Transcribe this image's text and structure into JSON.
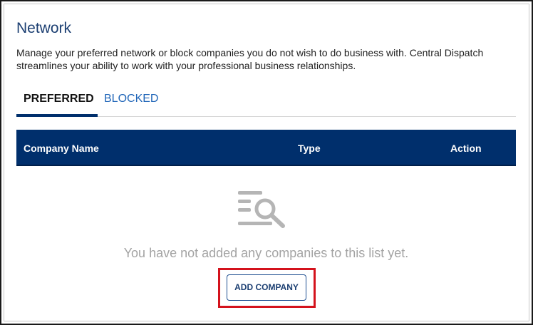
{
  "page": {
    "title": "Network",
    "description": "Manage your preferred network or block companies you do not wish to do business with. Central Dispatch streamlines your ability to work with your professional business relationships."
  },
  "tabs": [
    {
      "label": "PREFERRED",
      "active": true
    },
    {
      "label": "BLOCKED",
      "active": false
    }
  ],
  "table": {
    "columns": [
      "Company Name",
      "Type",
      "Action"
    ],
    "rows": []
  },
  "empty_state": {
    "icon": "list-search-icon",
    "message": "You have not added any companies to this list yet.",
    "button_label": "ADD COMPANY"
  },
  "colors": {
    "header_bg": "#002f6c",
    "title": "#1c3f72",
    "link": "#1f65b8",
    "highlight": "#d4121c",
    "muted_text": "#a3a3a3"
  }
}
